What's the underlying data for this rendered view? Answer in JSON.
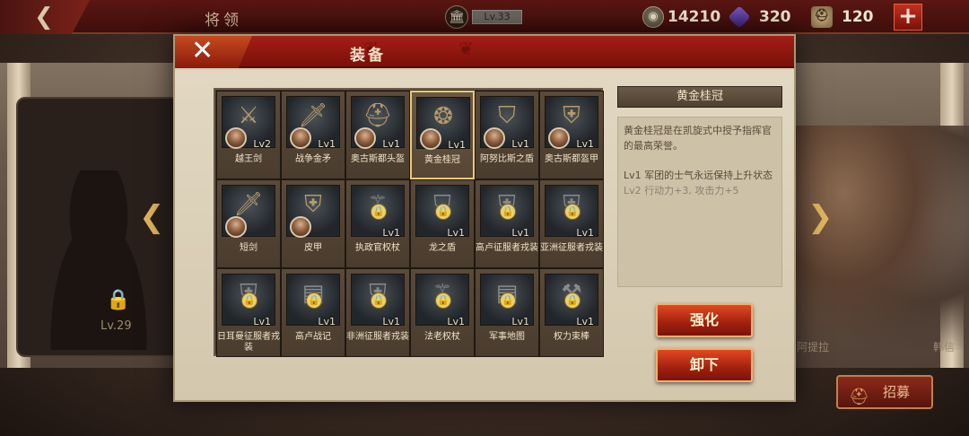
{
  "topbar": {
    "back_icon": "back-arrow-icon",
    "title": "将领",
    "rank_label": "Lv.33",
    "gold": "14210",
    "gems": "320",
    "helms": "120"
  },
  "background": {
    "left_level": "Lv.29",
    "right_name_1": "阿提拉",
    "right_name_2": "韩信"
  },
  "recruit": {
    "label": "招募"
  },
  "modal": {
    "title": "装备",
    "close_icon": "close-icon"
  },
  "items": [
    {
      "name": "越王剑",
      "lv": "Lv2",
      "art": "⚔",
      "locked": false,
      "avatar": true
    },
    {
      "name": "战争金矛",
      "lv": "Lv1",
      "art": "🗡",
      "locked": false,
      "avatar": true
    },
    {
      "name": "奥古斯都头盔",
      "lv": "Lv1",
      "art": "⛑",
      "locked": false,
      "avatar": true
    },
    {
      "name": "黄金桂冠",
      "lv": "Lv1",
      "art": "❂",
      "locked": false,
      "avatar": true,
      "selected": true
    },
    {
      "name": "阿努比斯之盾",
      "lv": "Lv1",
      "art": "⛉",
      "locked": false,
      "avatar": true
    },
    {
      "name": "奥古斯都盔甲",
      "lv": "Lv1",
      "art": "⛨",
      "locked": false,
      "avatar": true
    },
    {
      "name": "短剑",
      "lv": "",
      "art": "🗡",
      "locked": false,
      "avatar": true
    },
    {
      "name": "皮甲",
      "lv": "",
      "art": "⛨",
      "locked": false,
      "avatar": true
    },
    {
      "name": "执政官权杖",
      "lv": "Lv1",
      "art": "⚚",
      "locked": true,
      "avatar": false
    },
    {
      "name": "龙之盾",
      "lv": "Lv1",
      "art": "⛉",
      "locked": true,
      "avatar": false
    },
    {
      "name": "高卢征服者戎装",
      "lv": "Lv1",
      "art": "⛨",
      "locked": true,
      "avatar": false
    },
    {
      "name": "亚洲征服者戎装",
      "lv": "Lv1",
      "art": "⛨",
      "locked": true,
      "avatar": false
    },
    {
      "name": "日耳曼征服者戎装",
      "lv": "Lv1",
      "art": "⛨",
      "locked": true,
      "avatar": false
    },
    {
      "name": "高卢战记",
      "lv": "Lv1",
      "art": "▤",
      "locked": true,
      "avatar": false
    },
    {
      "name": "非洲征服者戎装",
      "lv": "Lv1",
      "art": "⛨",
      "locked": true,
      "avatar": false
    },
    {
      "name": "法老权杖",
      "lv": "Lv1",
      "art": "⚚",
      "locked": true,
      "avatar": false
    },
    {
      "name": "军事地图",
      "lv": "Lv1",
      "art": "▤",
      "locked": true,
      "avatar": false
    },
    {
      "name": "权力束棒",
      "lv": "Lv1",
      "art": "⚒",
      "locked": true,
      "avatar": false
    }
  ],
  "detail": {
    "title": "黄金桂冠",
    "description": "黄金桂冠是在凯旋式中授予指挥官的最高荣誉。",
    "effect_1": "Lv1  军团的士气永远保持上升状态",
    "effect_2": "Lv2  行动力+3, 攻击力+5"
  },
  "buttons": {
    "strengthen": "强化",
    "unequip": "卸下"
  },
  "colors": {
    "header_red": "#a41e16",
    "button_red": "#e04a22",
    "selected_border": "#e8c878"
  }
}
